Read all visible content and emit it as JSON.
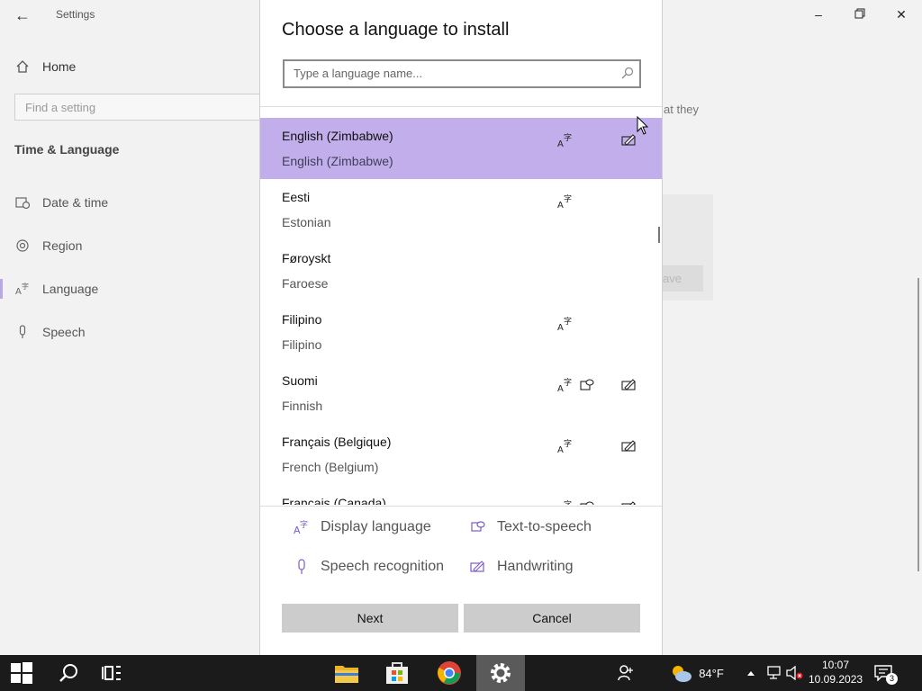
{
  "settings": {
    "window_title": "Settings",
    "home_label": "Home",
    "find_placeholder": "Find a setting",
    "section_title": "Time & Language",
    "nav": [
      {
        "label": "Date & time",
        "icon": "calendar-clock-icon"
      },
      {
        "label": "Region",
        "icon": "globe-icon"
      },
      {
        "label": "Language",
        "icon": "language-icon"
      },
      {
        "label": "Speech",
        "icon": "microphone-icon"
      }
    ],
    "background_text": "at they",
    "background_button": "ave"
  },
  "dialog": {
    "title": "Choose a language to install",
    "search_placeholder": "Type a language name...",
    "languages": [
      {
        "native": "English (Zimbabwe)",
        "english": "English (Zimbabwe)",
        "selected": true,
        "display": true,
        "tts": false,
        "handwriting": true
      },
      {
        "native": "Eesti",
        "english": "Estonian",
        "selected": false,
        "display": true,
        "tts": false,
        "handwriting": false
      },
      {
        "native": "Føroyskt",
        "english": "Faroese",
        "selected": false,
        "display": false,
        "tts": false,
        "handwriting": false
      },
      {
        "native": "Filipino",
        "english": "Filipino",
        "selected": false,
        "display": true,
        "tts": false,
        "handwriting": false
      },
      {
        "native": "Suomi",
        "english": "Finnish",
        "selected": false,
        "display": true,
        "tts": true,
        "handwriting": true
      },
      {
        "native": "Français (Belgique)",
        "english": "French (Belgium)",
        "selected": false,
        "display": true,
        "tts": false,
        "handwriting": true
      },
      {
        "native": "Français (Canada)",
        "english": "",
        "selected": false,
        "display": true,
        "tts": true,
        "handwriting": true
      }
    ],
    "legend": {
      "display_language": "Display language",
      "text_to_speech": "Text-to-speech",
      "speech_recognition": "Speech recognition",
      "handwriting": "Handwriting"
    },
    "next_label": "Next",
    "cancel_label": "Cancel"
  },
  "taskbar": {
    "weather_temp": "84°F",
    "time": "10:07",
    "date": "10.09.2023",
    "notification_count": "3",
    "apps": [
      "start-icon",
      "search-icon",
      "task-view-icon",
      "file-explorer-icon",
      "store-icon",
      "chrome-icon",
      "settings-icon"
    ]
  },
  "colors": {
    "accent_selected": "#c1aeeb",
    "icon_purple": "#7b5cc7",
    "button_gray": "#cccccc",
    "taskbar": "#1b1b1b"
  }
}
